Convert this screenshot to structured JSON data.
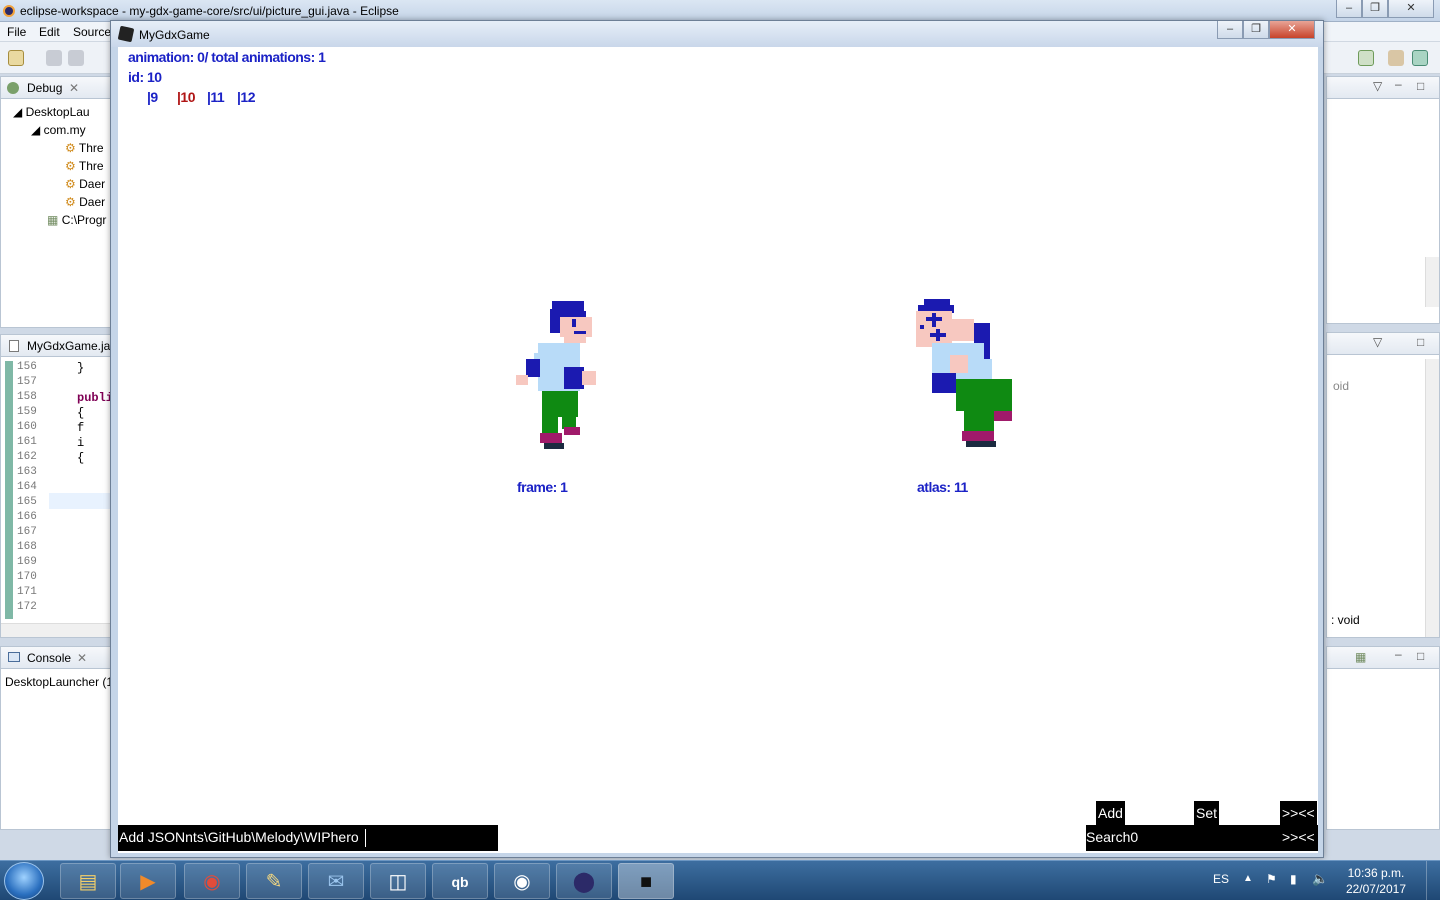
{
  "eclipse": {
    "title": "eclipse-workspace - my-gdx-game-core/src/ui/picture_gui.java - Eclipse",
    "menu": [
      "File",
      "Edit",
      "Source"
    ],
    "debug_panel": {
      "tab": "Debug",
      "tree": [
        "DesktopLau",
        "com.my",
        "Thre",
        "Thre",
        "Daer",
        "Daer",
        "C:\\Progr"
      ]
    },
    "editor": {
      "tab": "MyGdxGame.jav",
      "lines": [
        {
          "n": "156",
          "code": "}"
        },
        {
          "n": "157",
          "code": ""
        },
        {
          "n": "158",
          "code": "publi"
        },
        {
          "n": "159",
          "code": "{"
        },
        {
          "n": "160",
          "code": "f"
        },
        {
          "n": "161",
          "code": "i"
        },
        {
          "n": "162",
          "code": "{"
        },
        {
          "n": "163",
          "code": ""
        },
        {
          "n": "164",
          "code": ""
        },
        {
          "n": "165",
          "code": ""
        },
        {
          "n": "166",
          "code": ""
        },
        {
          "n": "167",
          "code": ""
        },
        {
          "n": "168",
          "code": ""
        },
        {
          "n": "169",
          "code": ""
        },
        {
          "n": "170",
          "code": ""
        },
        {
          "n": "171",
          "code": ""
        },
        {
          "n": "172",
          "code": ""
        }
      ]
    },
    "console": {
      "tab": "Console",
      "text": "DesktopLauncher (1"
    },
    "outline": {
      "void_label_1": "oid",
      "void_label_2": ": void"
    }
  },
  "game": {
    "title": "MyGdxGame",
    "animation_info": "animation: 0/ total animations: 1",
    "id_info": "id: 10",
    "frame_ids": [
      {
        "label": "|9",
        "selected": false
      },
      {
        "label": "|10",
        "selected": true
      },
      {
        "label": "|11",
        "selected": false
      },
      {
        "label": "|12",
        "selected": false
      }
    ],
    "frame_label": "frame: 1",
    "atlas_label": "atlas: 11",
    "input_value": "Add JSONnts\\GitHub\\Melody\\WIPhero",
    "input_star": "*",
    "buttons": {
      "add": "Add",
      "set": "Set",
      "nav_top": ">><<",
      "search": "Search0",
      "nav_bottom": ">><<"
    }
  },
  "taskbar": {
    "language": "ES",
    "time": "10:36 p.m.",
    "date": "22/07/2017",
    "apps": [
      "explorer",
      "media-player",
      "chrome",
      "paint",
      "thunderbird",
      "twitch",
      "qbittorrent",
      "gamepad",
      "eclipse",
      "libgdx"
    ]
  },
  "colors": {
    "hud_blue": "#1b22c6",
    "hud_red": "#b01515"
  }
}
